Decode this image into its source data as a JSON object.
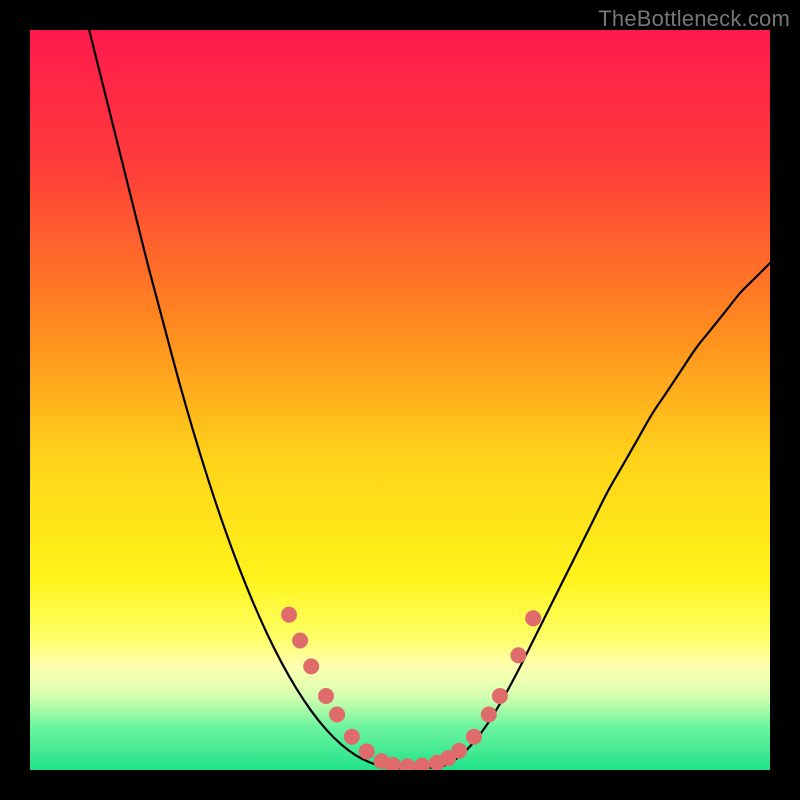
{
  "watermark": "TheBottleneck.com",
  "chart_data": {
    "type": "line",
    "title": "",
    "xlabel": "",
    "ylabel": "",
    "x_range": [
      0,
      100
    ],
    "y_range": [
      0,
      100
    ],
    "background_gradient_stops": [
      {
        "offset": 0.0,
        "color": "#ff1a4d"
      },
      {
        "offset": 0.18,
        "color": "#ff3b3b"
      },
      {
        "offset": 0.4,
        "color": "#ff8a1f"
      },
      {
        "offset": 0.58,
        "color": "#ffd31a"
      },
      {
        "offset": 0.74,
        "color": "#fff31a"
      },
      {
        "offset": 0.82,
        "color": "#ffff66"
      },
      {
        "offset": 0.86,
        "color": "#ffffb0"
      },
      {
        "offset": 0.9,
        "color": "#d6ffb0"
      },
      {
        "offset": 0.94,
        "color": "#70f5a0"
      },
      {
        "offset": 1.0,
        "color": "#1fe28a"
      }
    ],
    "series": [
      {
        "name": "left-curve",
        "color": "#000000",
        "width": 2.2,
        "points": [
          {
            "x": 8.0,
            "y": 100.0
          },
          {
            "x": 10.0,
            "y": 92.0
          },
          {
            "x": 12.0,
            "y": 84.0
          },
          {
            "x": 14.0,
            "y": 76.0
          },
          {
            "x": 16.0,
            "y": 68.0
          },
          {
            "x": 18.0,
            "y": 60.5
          },
          {
            "x": 20.0,
            "y": 53.0
          },
          {
            "x": 22.0,
            "y": 46.0
          },
          {
            "x": 24.0,
            "y": 39.5
          },
          {
            "x": 26.0,
            "y": 33.5
          },
          {
            "x": 28.0,
            "y": 28.0
          },
          {
            "x": 30.0,
            "y": 23.0
          },
          {
            "x": 32.0,
            "y": 18.5
          },
          {
            "x": 34.0,
            "y": 14.5
          },
          {
            "x": 36.0,
            "y": 11.0
          },
          {
            "x": 38.0,
            "y": 8.0
          },
          {
            "x": 40.0,
            "y": 5.5
          },
          {
            "x": 42.0,
            "y": 3.5
          },
          {
            "x": 44.0,
            "y": 2.0
          },
          {
            "x": 46.0,
            "y": 1.0
          },
          {
            "x": 48.0,
            "y": 0.4
          }
        ]
      },
      {
        "name": "valley-floor",
        "color": "#000000",
        "width": 2.2,
        "points": [
          {
            "x": 48.0,
            "y": 0.4
          },
          {
            "x": 50.0,
            "y": 0.2
          },
          {
            "x": 52.0,
            "y": 0.2
          },
          {
            "x": 54.0,
            "y": 0.3
          },
          {
            "x": 56.0,
            "y": 0.6
          }
        ]
      },
      {
        "name": "right-curve",
        "color": "#000000",
        "width": 2.2,
        "points": [
          {
            "x": 56.0,
            "y": 0.6
          },
          {
            "x": 58.0,
            "y": 1.8
          },
          {
            "x": 60.0,
            "y": 3.8
          },
          {
            "x": 62.0,
            "y": 6.5
          },
          {
            "x": 64.0,
            "y": 9.8
          },
          {
            "x": 66.0,
            "y": 13.5
          },
          {
            "x": 68.0,
            "y": 17.5
          },
          {
            "x": 70.0,
            "y": 21.5
          },
          {
            "x": 72.0,
            "y": 25.5
          },
          {
            "x": 74.0,
            "y": 29.5
          },
          {
            "x": 76.0,
            "y": 33.5
          },
          {
            "x": 78.0,
            "y": 37.5
          },
          {
            "x": 80.0,
            "y": 41.0
          },
          {
            "x": 82.0,
            "y": 44.5
          },
          {
            "x": 84.0,
            "y": 48.0
          },
          {
            "x": 86.0,
            "y": 51.0
          },
          {
            "x": 88.0,
            "y": 54.0
          },
          {
            "x": 90.0,
            "y": 57.0
          },
          {
            "x": 92.0,
            "y": 59.5
          },
          {
            "x": 94.0,
            "y": 62.0
          },
          {
            "x": 96.0,
            "y": 64.5
          },
          {
            "x": 98.0,
            "y": 66.5
          },
          {
            "x": 100.0,
            "y": 68.5
          }
        ]
      }
    ],
    "markers": {
      "color": "#e06b6b",
      "radius": 8,
      "points": [
        {
          "x": 35.0,
          "y": 21.0
        },
        {
          "x": 36.5,
          "y": 17.5
        },
        {
          "x": 38.0,
          "y": 14.0
        },
        {
          "x": 40.0,
          "y": 10.0
        },
        {
          "x": 41.5,
          "y": 7.5
        },
        {
          "x": 43.5,
          "y": 4.5
        },
        {
          "x": 45.5,
          "y": 2.5
        },
        {
          "x": 47.5,
          "y": 1.2
        },
        {
          "x": 49.0,
          "y": 0.7
        },
        {
          "x": 51.0,
          "y": 0.5
        },
        {
          "x": 53.0,
          "y": 0.6
        },
        {
          "x": 55.0,
          "y": 1.0
        },
        {
          "x": 56.5,
          "y": 1.6
        },
        {
          "x": 58.0,
          "y": 2.6
        },
        {
          "x": 60.0,
          "y": 4.5
        },
        {
          "x": 62.0,
          "y": 7.5
        },
        {
          "x": 63.5,
          "y": 10.0
        },
        {
          "x": 66.0,
          "y": 15.5
        },
        {
          "x": 68.0,
          "y": 20.5
        }
      ]
    }
  }
}
